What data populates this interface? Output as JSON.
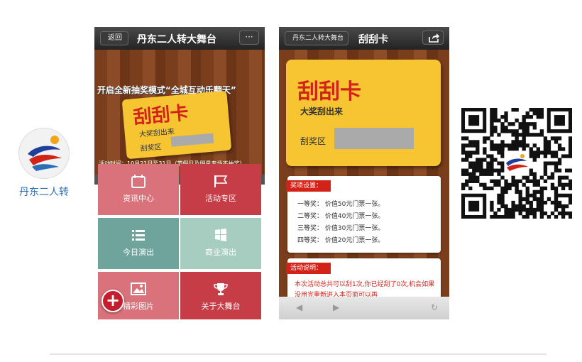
{
  "brand": {
    "name": "丹东二人转"
  },
  "phone1": {
    "back_label": "返回",
    "title": "丹东二人转大舞台",
    "more_label": "···",
    "banner": {
      "headline": "开启全新抽奖模式“全城互动乐翻天”",
      "card_title": "刮刮卡",
      "card_sub": "大奖刮出来",
      "card_zone": "刮奖区",
      "time": "活动时间：10月21日至31日（节假日及明星专场不抽奖）"
    },
    "tiles": [
      {
        "label": "资讯中心",
        "icon": "calendar-icon",
        "color": "#d9727a"
      },
      {
        "label": "活动专区",
        "icon": "flag-icon",
        "color": "#c63d47"
      },
      {
        "label": "今日演出",
        "icon": "list-icon",
        "color": "#6fa49d"
      },
      {
        "label": "商业演出",
        "icon": "windows-icon",
        "color": "#a6cdbf"
      },
      {
        "label": "精彩图片",
        "icon": "image-icon",
        "color": "#d9727a"
      },
      {
        "label": "关于大舞台",
        "icon": "trophy-icon",
        "color": "#c63d47"
      }
    ],
    "plus_label": "+"
  },
  "phone2": {
    "back_label": "丹东二人转大舞台",
    "title": "刮刮卡",
    "card_title": "刮刮卡",
    "card_sub": "大奖刮出来",
    "card_zone": "刮奖区",
    "prize_tag": "奖项设置：",
    "prizes": [
      "一等奖：  价值50元门票一张。",
      "二等奖：  价值40元门票一张。",
      "三等奖：  价值30元门票一张。",
      "四等奖：  价值20元门票一张。"
    ],
    "rule_tag": "活动说明：",
    "rule_text": "本次活动总共可以刮1次,你已经刮了0次,机会如果没用完重新进入本页面可以再",
    "nav": {
      "back": "◀",
      "forward": "▶",
      "refresh": "↻"
    }
  }
}
